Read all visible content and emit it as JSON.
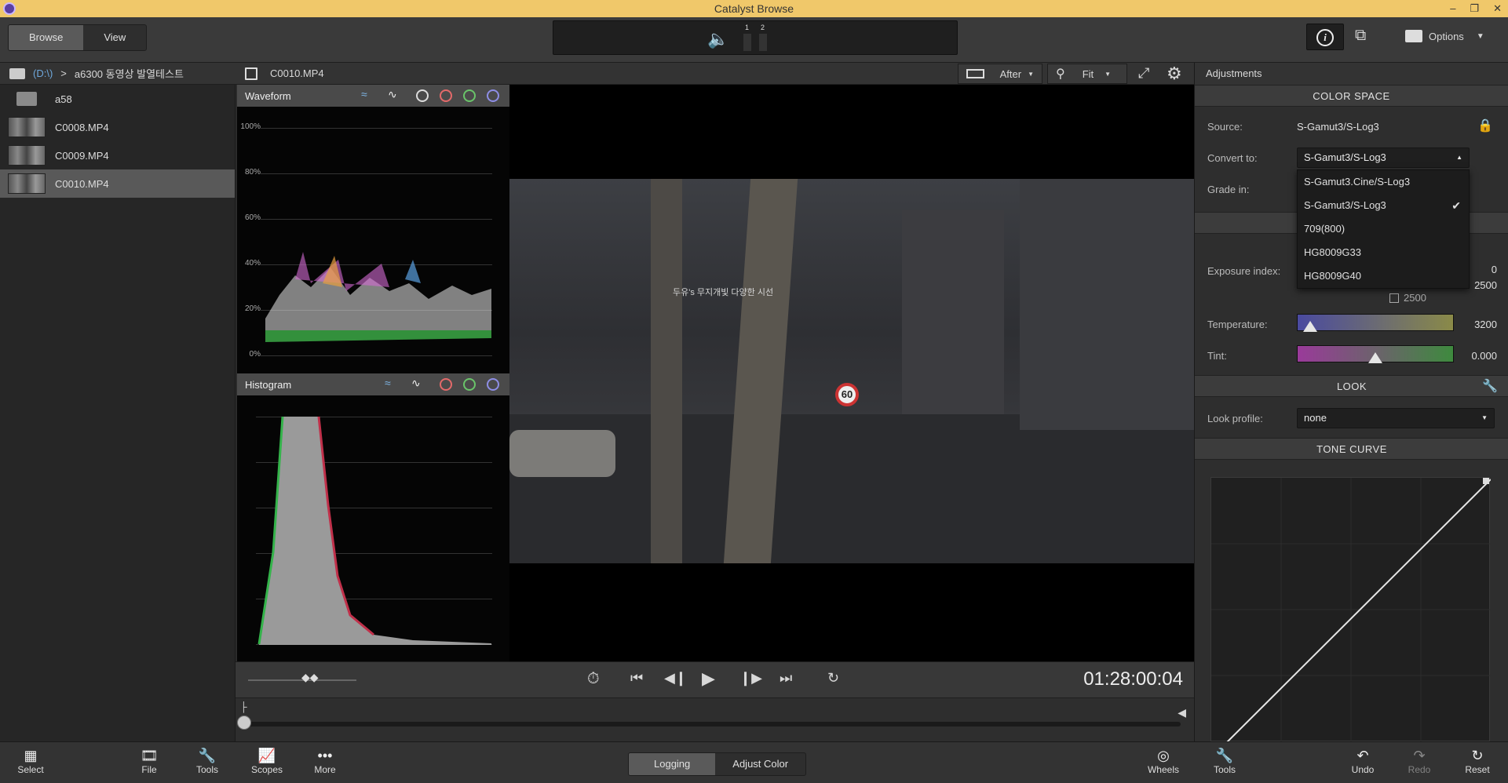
{
  "window": {
    "title": "Catalyst Browse"
  },
  "topbar": {
    "tabs": [
      {
        "label": "Browse",
        "active": true
      },
      {
        "label": "View",
        "active": false
      }
    ],
    "audio": {
      "channels": [
        "1",
        "2"
      ]
    },
    "options_label": "Options"
  },
  "pathbar": {
    "drive": "(D:\\)",
    "separator": ">",
    "folder": "a6300 동영상 발열테스트"
  },
  "browser": {
    "items": [
      {
        "type": "folder",
        "name": "a58"
      },
      {
        "type": "clip",
        "name": "C0008.MP4"
      },
      {
        "type": "clip",
        "name": "C0009.MP4"
      },
      {
        "type": "clip",
        "name": "C0010.MP4",
        "selected": true
      }
    ]
  },
  "viewer": {
    "clip_name": "C0010.MP4",
    "compare_mode": "After",
    "zoom": "Fit",
    "timecode": "01:28:00:04",
    "overlay_text": "두유's 무지개빛 다양한 시선",
    "sign_speed": "60"
  },
  "scopes": {
    "waveform": {
      "title": "Waveform",
      "y_labels": [
        "100%",
        "80%",
        "60%",
        "40%",
        "20%",
        "0%"
      ]
    },
    "histogram": {
      "title": "Histogram"
    }
  },
  "adjustments": {
    "title": "Adjustments",
    "color_space": {
      "header": "COLOR SPACE",
      "source_label": "Source:",
      "source_value": "S-Gamut3/S-Log3",
      "convert_label": "Convert to:",
      "convert_value": "S-Gamut3/S-Log3",
      "grade_label": "Grade in:",
      "options": [
        "S-Gamut3.Cine/S-Log3",
        "S-Gamut3/S-Log3",
        "709(800)",
        "HG8009G33",
        "HG8009G40"
      ],
      "selected_option": "S-Gamut3/S-Log3"
    },
    "exposure": {
      "label": "Exposure index:",
      "value_top": "0",
      "value": "2500",
      "sub_value": "2500"
    },
    "temperature": {
      "label": "Temperature:",
      "value": "3200",
      "level": 0.04
    },
    "tint": {
      "label": "Tint:",
      "value": "0.000",
      "level": 0.5
    },
    "look": {
      "header": "LOOK",
      "profile_label": "Look profile:",
      "profile_value": "none"
    },
    "tone_curve": {
      "header": "TONE CURVE"
    }
  },
  "bottombar": {
    "left": [
      "Select",
      "File",
      "Tools",
      "Scopes",
      "More"
    ],
    "modes": [
      {
        "label": "Logging",
        "active": true
      },
      {
        "label": "Adjust Color",
        "active": false
      }
    ],
    "wheels": "Wheels",
    "right": [
      "Tools",
      "Undo",
      "Redo",
      "Reset"
    ]
  }
}
